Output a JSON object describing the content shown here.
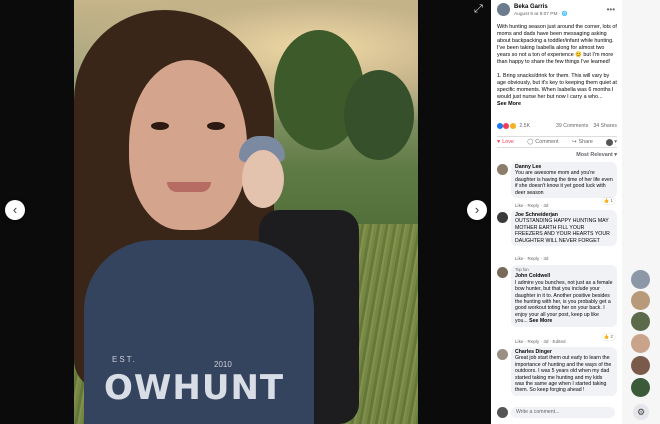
{
  "post": {
    "author": "Beka Garris",
    "date": "August 9 at 8:07 PM · ",
    "text": "With hunting season just around the corner, lots of moms and dads have been messaging asking about backpacking a toddler/infant while hunting. I've been taking Isabella along for almost two years so not a ton of experience 😊 but I'm more than happy to share the few things I've learned!",
    "text2": "1. Bring snacks/drink for them. This will vary by age obviously, but it's key to keeping them quiet at specific moments. When Isabella was 6 months I would just nurse her but now I carry a who...",
    "see_more": "See More",
    "reaction_count": "2.5K",
    "comments_count": "39 Comments",
    "shares_count": "34 Shares"
  },
  "photo": {
    "shirt_small": "EST.",
    "shirt_year": "2010",
    "shirt_text": "OWHUNT"
  },
  "actions": {
    "love": "Love",
    "comment": "Comment",
    "share": "Share"
  },
  "sort_label": "Most Relevant ▾",
  "comments": [
    {
      "name": "Danny Lee",
      "text": "You are awesome mom and you're daughter is having the time of her life even if she doesn't know it yet good luck with deer season",
      "meta": "Like · Reply · 3d",
      "badge": "1"
    },
    {
      "name": "Joe Schneiderjan",
      "text": "OUTSTANDING HAPPY HUNTING MAY MOTHER EARTH FILL YOUR FREEZERS AND YOUR HEARTS YOUR DAUGHTER WILL NEVER FORGET",
      "meta": "Like · Reply · 3d"
    },
    {
      "top_fan": "Top fan",
      "name": "John Coldwell",
      "text": "I admire you bunches, not just as a female bow hunter, but that you include your daughter in it to. Another positive besides the hunting with her, is you probably get a good workout toting her on your back. I enjoy your all your post, keep up like you...",
      "see_more": "See More",
      "meta": "Like · Reply · 3d · Edited",
      "badge": "2"
    },
    {
      "name": "Charles Dinger",
      "text": "Great job start them out early to learn the importance of hunting and the ways of the outdoors. I was 5 years old when my dad started taking me hunting and my kids was the same age when I started taking them. So keep forging ahead !",
      "meta": ""
    }
  ],
  "write_placeholder": "Write a comment...",
  "colors": {
    "like": "#1877f2",
    "love": "#f33e58",
    "wow": "#f7b125",
    "link": "#050505"
  }
}
